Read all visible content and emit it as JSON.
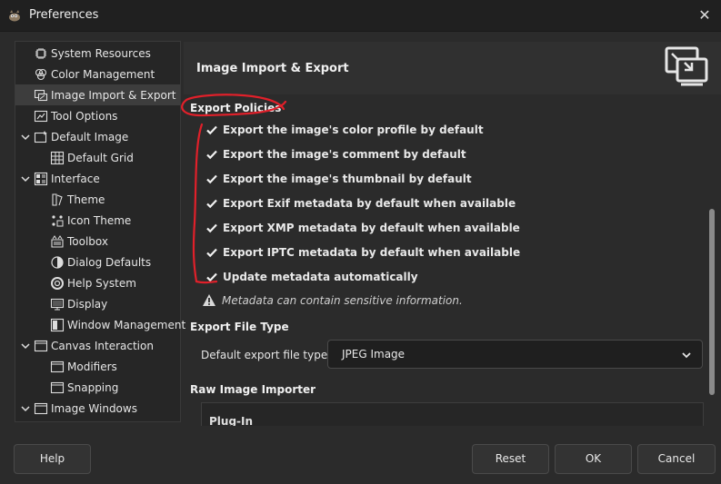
{
  "window": {
    "title": "Preferences",
    "close_glyph": "✕",
    "app_icon": "gimp-wilber-icon"
  },
  "sidebar": {
    "items": [
      {
        "label": "System Resources",
        "icon": "chip-icon"
      },
      {
        "label": "Color Management",
        "icon": "color-management-icon"
      },
      {
        "label": "Image Import & Export",
        "icon": "import-export-icon",
        "selected": true
      },
      {
        "label": "Tool Options",
        "icon": "tool-options-icon"
      },
      {
        "label": "Default Image",
        "icon": "default-image-icon",
        "expanded": true
      },
      {
        "label": "Default Grid",
        "icon": "grid-icon"
      },
      {
        "label": "Interface",
        "icon": "interface-icon",
        "expanded": true
      },
      {
        "label": "Theme",
        "icon": "theme-icon"
      },
      {
        "label": "Icon Theme",
        "icon": "icon-theme-icon"
      },
      {
        "label": "Toolbox",
        "icon": "toolbox-icon"
      },
      {
        "label": "Dialog Defaults",
        "icon": "dialog-defaults-icon"
      },
      {
        "label": "Help System",
        "icon": "help-system-icon"
      },
      {
        "label": "Display",
        "icon": "display-icon"
      },
      {
        "label": "Window Management",
        "icon": "window-management-icon"
      },
      {
        "label": "Canvas Interaction",
        "icon": "canvas-interaction-icon",
        "expanded": true
      },
      {
        "label": "Modifiers",
        "icon": "modifiers-icon"
      },
      {
        "label": "Snapping",
        "icon": "snapping-icon"
      },
      {
        "label": "Image Windows",
        "icon": "image-windows-icon",
        "expanded": true
      }
    ]
  },
  "header": {
    "title": "Image Import & Export",
    "icon": "import-export-large-icon"
  },
  "export_policies": {
    "title": "Export Policies",
    "options": [
      {
        "label": "Export the image's color profile by default",
        "checked": true
      },
      {
        "label": "Export the image's comment by default",
        "checked": true
      },
      {
        "label": "Export the image's thumbnail by default",
        "checked": true
      },
      {
        "label": "Export Exif metadata by default when available",
        "checked": true
      },
      {
        "label": "Export XMP metadata by default when available",
        "checked": true
      },
      {
        "label": "Export IPTC metadata by default when available",
        "checked": true
      },
      {
        "label": "Update metadata automatically",
        "checked": true
      }
    ],
    "warning": "Metadata can contain sensitive information."
  },
  "export_file_type": {
    "title": "Export File Type",
    "label": "Default export file type:",
    "value": "JPEG Image"
  },
  "raw_importer": {
    "title": "Raw Image Importer",
    "plugin_label": "Plug-In"
  },
  "buttons": {
    "help": "Help",
    "reset": "Reset",
    "ok": "OK",
    "cancel": "Cancel"
  },
  "colors": {
    "background": "#2b2b2b",
    "titlebar": "#202020",
    "sidebar_selected": "#3d3d3d",
    "annotation": "#e0202a",
    "warning": "#d9d9d9"
  }
}
